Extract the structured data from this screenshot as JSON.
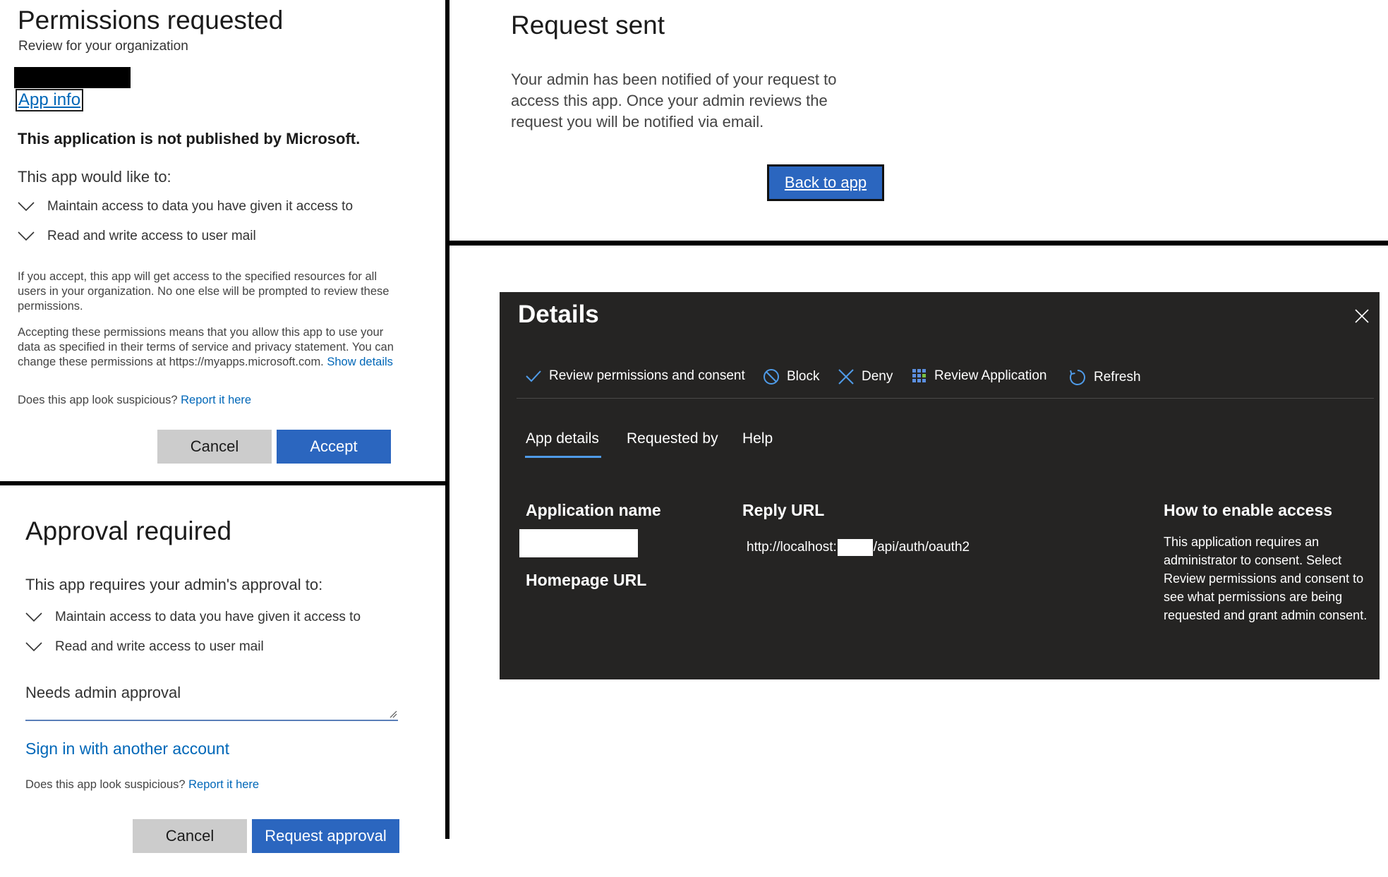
{
  "permissions_panel": {
    "title": "Permissions requested",
    "subtitle": "Review for your organization",
    "app_info_link": "App info",
    "not_published": "This application is not published by Microsoft.",
    "would_like": "This app would like to:",
    "permissions": [
      "Maintain access to data you have given it access to",
      "Read and write access to user mail"
    ],
    "paragraph1": "If you accept, this app will get access to the specified resources for all users in your organization. No one else will be prompted to review these permissions.",
    "paragraph2": "Accepting these permissions means that you allow this app to use your data as specified in their terms of service and privacy statement. You can change these permissions at https://myapps.microsoft.com.",
    "show_details_link": "Show details",
    "suspicious_text": "Does this app look suspicious?",
    "report_link": "Report it here",
    "cancel_label": "Cancel",
    "accept_label": "Accept"
  },
  "approval_panel": {
    "title": "Approval required",
    "requires_text": "This app requires your admin's approval to:",
    "permissions": [
      "Maintain access to data you have given it access to",
      "Read and write access to user mail"
    ],
    "justification_value": "Needs admin approval",
    "sign_in_link": "Sign in with another account",
    "suspicious_text": "Does this app look suspicious?",
    "report_link": "Report it here",
    "cancel_label": "Cancel",
    "request_label": "Request approval"
  },
  "request_sent_panel": {
    "title": "Request sent",
    "body": "Your admin has been notified of your request to access this app. Once your admin reviews the request you will be notified via email.",
    "back_label": "Back to app"
  },
  "details_panel": {
    "title": "Details",
    "toolbar": {
      "review_label": "Review permissions and consent",
      "block_label": "Block",
      "deny_label": "Deny",
      "review_app_label": "Review Application",
      "refresh_label": "Refresh"
    },
    "tabs": [
      "App details",
      "Requested by",
      "Help"
    ],
    "active_tab": "App details",
    "application_name_label": "Application name",
    "homepage_url_label": "Homepage URL",
    "reply_url_label": "Reply URL",
    "reply_url_prefix": "http://localhost:",
    "reply_url_suffix": "/api/auth/oauth2",
    "how_to_label": "How to enable access",
    "how_to_body": "This application requires an administrator to consent. Select Review permissions and consent to see what permissions are being requested and grant admin consent."
  },
  "colors": {
    "primary_button": "#2b66bf",
    "link": "#0067b8",
    "details_background": "#252423",
    "tab_accent": "#4f9be8"
  }
}
